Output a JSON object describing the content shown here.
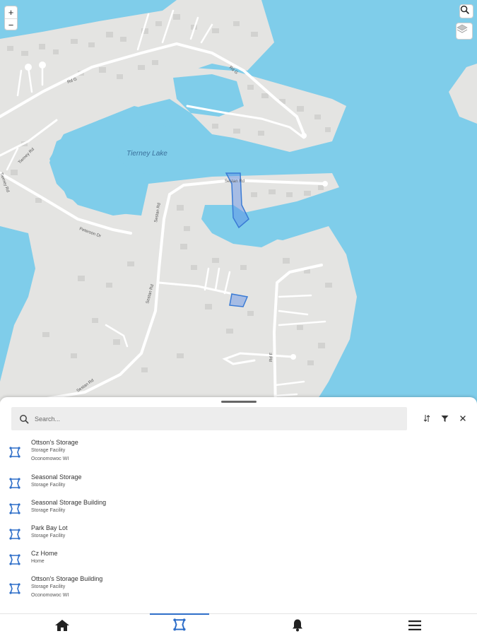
{
  "map": {
    "lake_label": "Tierney Lake",
    "roads": [
      "Rd G",
      "Tierney Rd",
      "Peterson Dr",
      "Sestan Rd",
      "Sestan Rd",
      "Sestan Rd",
      "Rd F"
    ],
    "colors": {
      "water": "#7fcdea",
      "land": "#e4e4e2",
      "road": "#ffffff",
      "building": "#d2d2d0",
      "parcel": "#3a7bd5"
    },
    "controls": {
      "zoom_in": "+",
      "zoom_out": "−",
      "search_icon": "search-icon",
      "layers_icon": "layers-icon"
    }
  },
  "sheet": {
    "search_placeholder": "Search...",
    "tools": [
      "sort-icon",
      "filter-icon",
      "close-icon"
    ],
    "items": [
      {
        "name": "Ottson's Storage",
        "type": "Storage Facility",
        "location": "Oconomowoc WI"
      },
      {
        "name": "Seasonal Storage",
        "type": "Storage Facility",
        "location": ""
      },
      {
        "name": "Seasonal Storage Building",
        "type": "Storage Facility",
        "location": ""
      },
      {
        "name": "Park Bay Lot",
        "type": "Storage Facility",
        "location": ""
      },
      {
        "name": "Cz Home",
        "type": "Home",
        "location": ""
      },
      {
        "name": "Ottson's Storage Building",
        "type": "Storage Facility",
        "location": "Oconomowoc WI"
      }
    ]
  },
  "tabbar": {
    "tabs": [
      {
        "icon": "home-icon",
        "active": false
      },
      {
        "icon": "parcel-flag-icon",
        "active": true
      },
      {
        "icon": "bell-icon",
        "active": false
      },
      {
        "icon": "menu-icon",
        "active": false
      }
    ],
    "active_color": "#2f6fc9"
  }
}
